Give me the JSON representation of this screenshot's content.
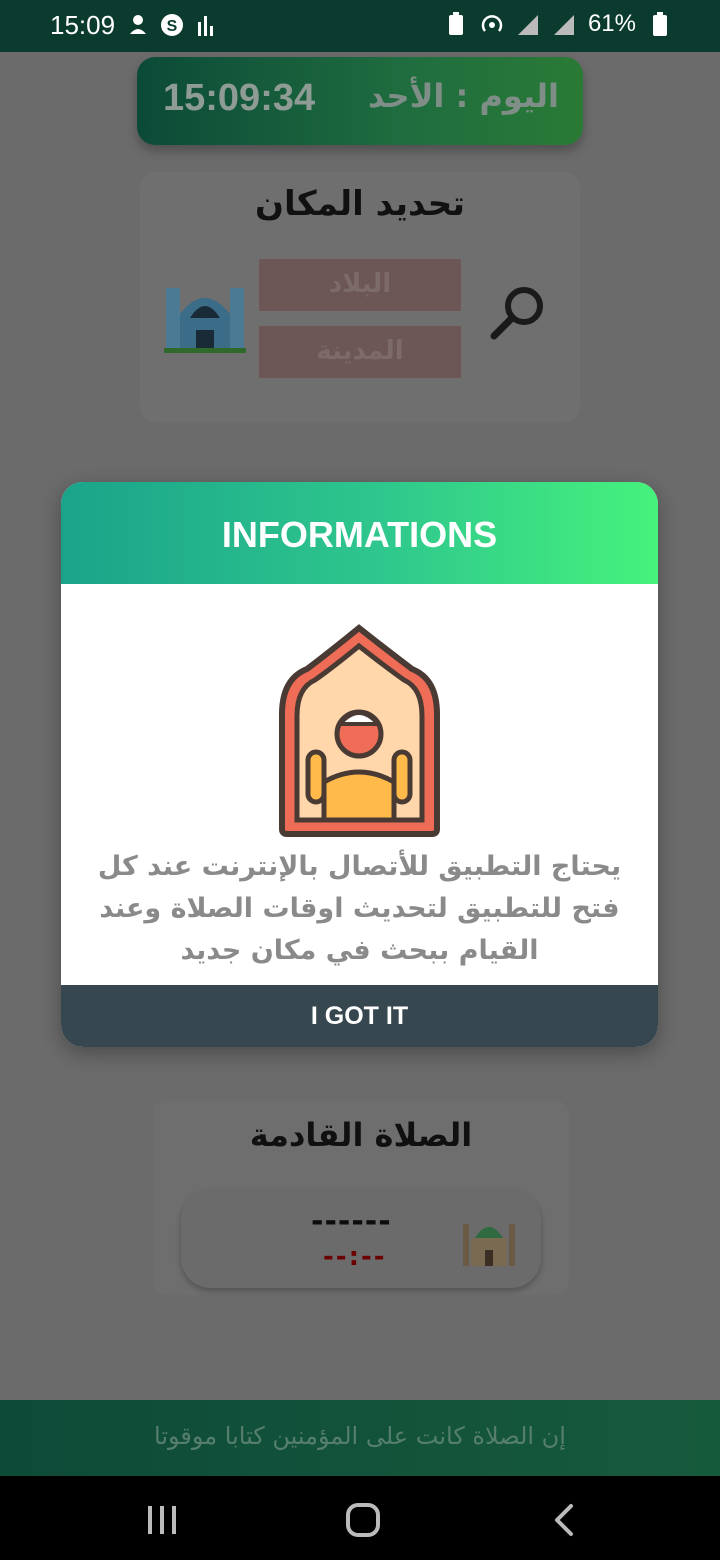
{
  "status_bar": {
    "time": "15:09",
    "battery": "61%"
  },
  "clock_card": {
    "time": "15:09:34",
    "day": "اليوم : الأحد"
  },
  "location": {
    "title": "تحديد المكان",
    "country_placeholder": "البلاد",
    "city_placeholder": "المدينة"
  },
  "dialog": {
    "title": "INFORMATIONS",
    "message": "يحتاج التطبيق للأتصال بالإنترنت عند كل فتح للتطبيق لتحديث اوقات الصلاة وعند القيام ببحث في مكان جديد",
    "button_label": "I GOT IT"
  },
  "next_prayer": {
    "title": "الصلاة القادمة",
    "name": "------",
    "time": "--:--"
  },
  "quote": "إن الصلاة كانت على المؤمنين كتابا موقوتا",
  "colors": {
    "header_gradient_start": "#1aa38a",
    "header_gradient_end": "#46f27c",
    "button_bg": "#37474f",
    "status_bar_bg": "#0b3b2e"
  }
}
